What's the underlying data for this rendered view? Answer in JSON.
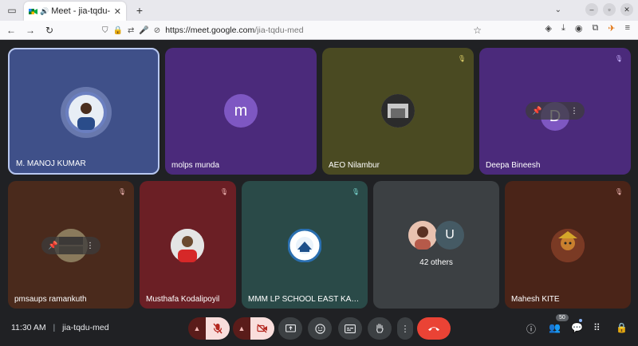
{
  "browser": {
    "tab_title": "Meet - jia-tqdu-med",
    "url_host": "https://meet.google.com",
    "url_path": "/jia-tqdu-med",
    "new_tab": "+",
    "close_tab": "✕"
  },
  "tiles": [
    {
      "name": "M. MANOJ KUMAR",
      "bg": "#3f5089",
      "muted": false,
      "avatar": "photo",
      "speaking": true
    },
    {
      "name": "molps munda",
      "bg": "#4b2a7b",
      "muted": false,
      "avatar": "letter",
      "letter": "m",
      "avatar_color": "#7e57c2"
    },
    {
      "name": "AEO Nilambur",
      "bg": "#4a4a22",
      "muted": true,
      "avatar": "photo"
    },
    {
      "name": "Deepa Bineesh",
      "bg": "#4b2a7b",
      "muted": true,
      "avatar": "letter",
      "letter": "D"
    },
    {
      "name": "pmsaups ramankuth",
      "bg": "#4a2a1c",
      "muted": true,
      "avatar": "photo"
    },
    {
      "name": "Musthafa Kodalipoyil",
      "bg": "#6b1f25",
      "muted": true,
      "avatar": "photo"
    },
    {
      "name": "MMM LP SCHOOL EAST KALK...",
      "bg": "#2a4a48",
      "muted": true,
      "avatar": "photo"
    },
    {
      "name": "42 others",
      "bg": "#3c4043",
      "muted": false,
      "avatar": "group",
      "letter": "U"
    },
    {
      "name": "Mahesh KITE",
      "bg": "#4a2418",
      "muted": true,
      "avatar": "photo"
    }
  ],
  "footer": {
    "time": "11:30 AM",
    "separator": "|",
    "meeting_code": "jia-tqdu-med",
    "participants_count": "50"
  },
  "colors": {
    "end_call": "#ea4335",
    "muted_button": "#f9dedc",
    "speaking_border": "#b8c7f0"
  }
}
